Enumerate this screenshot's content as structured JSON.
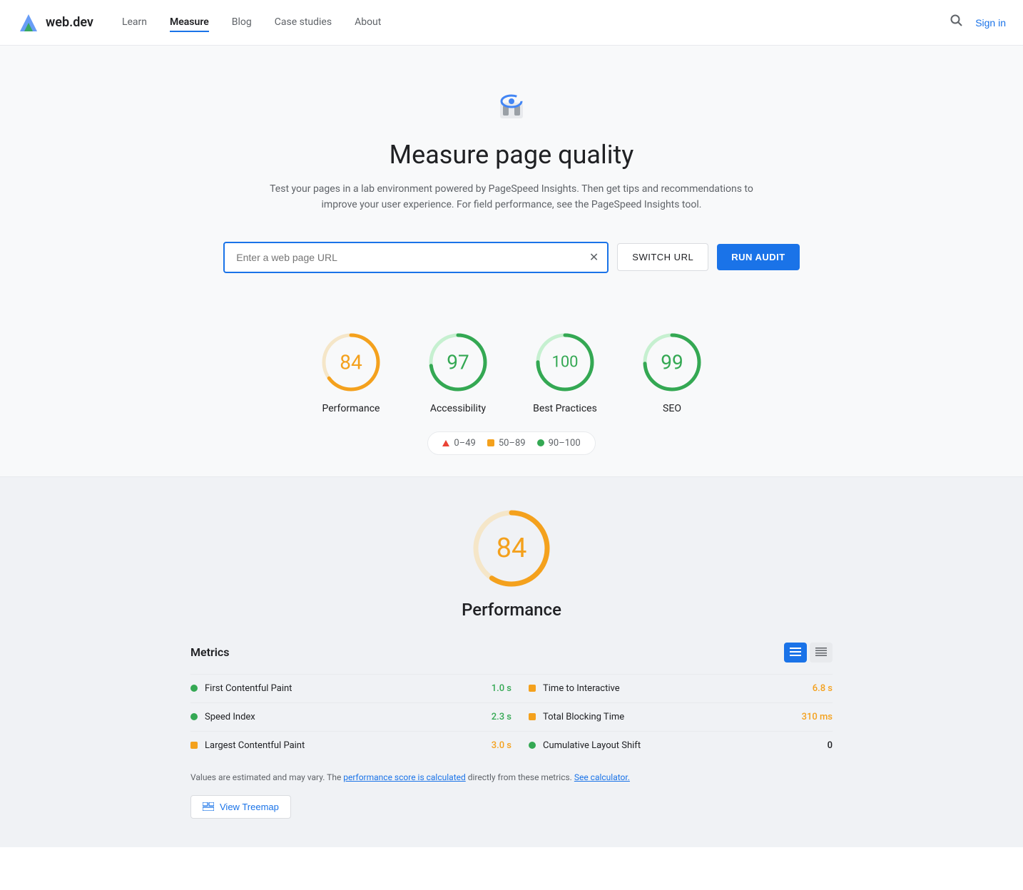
{
  "nav": {
    "logo_text": "web.dev",
    "links": [
      {
        "label": "Learn",
        "active": false
      },
      {
        "label": "Measure",
        "active": true
      },
      {
        "label": "Blog",
        "active": false
      },
      {
        "label": "Case studies",
        "active": false
      },
      {
        "label": "About",
        "active": false
      }
    ],
    "sign_in_label": "Sign in"
  },
  "hero": {
    "title": "Measure page quality",
    "description": "Test your pages in a lab environment powered by PageSpeed Insights. Then get tips and recommendations to improve your user experience. For field performance, see the PageSpeed Insights tool."
  },
  "url_input": {
    "placeholder": "Enter a web page URL",
    "value": ""
  },
  "buttons": {
    "switch_url": "SWITCH URL",
    "run_audit": "RUN AUDIT",
    "view_treemap": "View Treemap"
  },
  "scores": [
    {
      "label": "Performance",
      "value": 84,
      "color": "#f4a11d",
      "ring_color": "#f4a11d",
      "bg_color": "#fef3e0"
    },
    {
      "label": "Accessibility",
      "value": 97,
      "color": "#34a853",
      "ring_color": "#34a853",
      "bg_color": "#e6f4ea"
    },
    {
      "label": "Best Practices",
      "value": 100,
      "color": "#34a853",
      "ring_color": "#34a853",
      "bg_color": "#e6f4ea"
    },
    {
      "label": "SEO",
      "value": 99,
      "color": "#34a853",
      "ring_color": "#34a853",
      "bg_color": "#e6f4ea"
    }
  ],
  "legend": [
    {
      "type": "triangle",
      "color": "#ea4335",
      "range": "0–49"
    },
    {
      "type": "square",
      "color": "#f4a11d",
      "range": "50–89"
    },
    {
      "type": "circle",
      "color": "#34a853",
      "range": "90–100"
    }
  ],
  "performance": {
    "score": 84,
    "title": "Performance",
    "metrics_title": "Metrics",
    "metrics": [
      {
        "col": 0,
        "indicator": "circle",
        "color": "#34a853",
        "name": "First Contentful Paint",
        "value": "1.0 s",
        "val_class": "val-green"
      },
      {
        "col": 1,
        "indicator": "square",
        "color": "#f4a11d",
        "name": "Time to Interactive",
        "value": "6.8 s",
        "val_class": "val-orange"
      },
      {
        "col": 0,
        "indicator": "circle",
        "color": "#34a853",
        "name": "Speed Index",
        "value": "2.3 s",
        "val_class": "val-green"
      },
      {
        "col": 1,
        "indicator": "square",
        "color": "#f4a11d",
        "name": "Total Blocking Time",
        "value": "310 ms",
        "val_class": "val-orange"
      },
      {
        "col": 0,
        "indicator": "square",
        "color": "#f4a11d",
        "name": "Largest Contentful Paint",
        "value": "3.0 s",
        "val_class": "val-orange"
      },
      {
        "col": 1,
        "indicator": "circle",
        "color": "#34a853",
        "name": "Cumulative Layout Shift",
        "value": "0",
        "val_class": "val-black"
      }
    ],
    "note_prefix": "Values are estimated and may vary. The ",
    "note_link1": "performance score is calculated",
    "note_mid": " directly from these metrics. ",
    "note_link2": "See calculator.",
    "note_suffix": ""
  }
}
